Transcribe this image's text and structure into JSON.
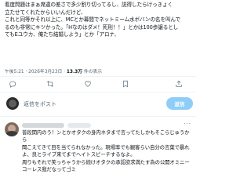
{
  "post": {
    "lines": [
      "看度問題はまぁ席違の差さで多少割り切ってるし、説得したらけっきょく",
      "立たせてくれたからいいんだけど、",
      "これと同等かそれ以上に、MCとか幕間でネットミーム水ボバンの名を叫んで",
      "るのも非常にキツかった。「Hなのはダメ！死刑！！」とかは100歩譲るとし",
      "てもEユウカ、俺たち結婚しよう」とか「アロナ、"
    ],
    "timestamp": "午後5:21 · 2026年3月23日 · ",
    "views_count": "13.3万",
    "views_label": " 件の表示"
  },
  "actions": [
    "reply-icon",
    "retweet-icon",
    "like-icon",
    "bookmark-icon",
    "share-icon"
  ],
  "reply_box": {
    "placeholder": "返信をポスト",
    "button_label": "返信"
  },
  "comment": {
    "more": "···",
    "lines": [
      "普段関内のう！ンとかオタクの身内ネタまで言ってたしかもそこらじゅうから",
      "聞こえてきて目を当てられなかった。現場率でも観客らい自分の言葉で暴れ",
      "よ、良とライブ来てまでヘイトスピーチするなよ。",
      "周りもそれで笑っちゃうから続けオタクの承認欲求満たす為の公開オミニー",
      "コーレス我だなってゴミ"
    ]
  }
}
